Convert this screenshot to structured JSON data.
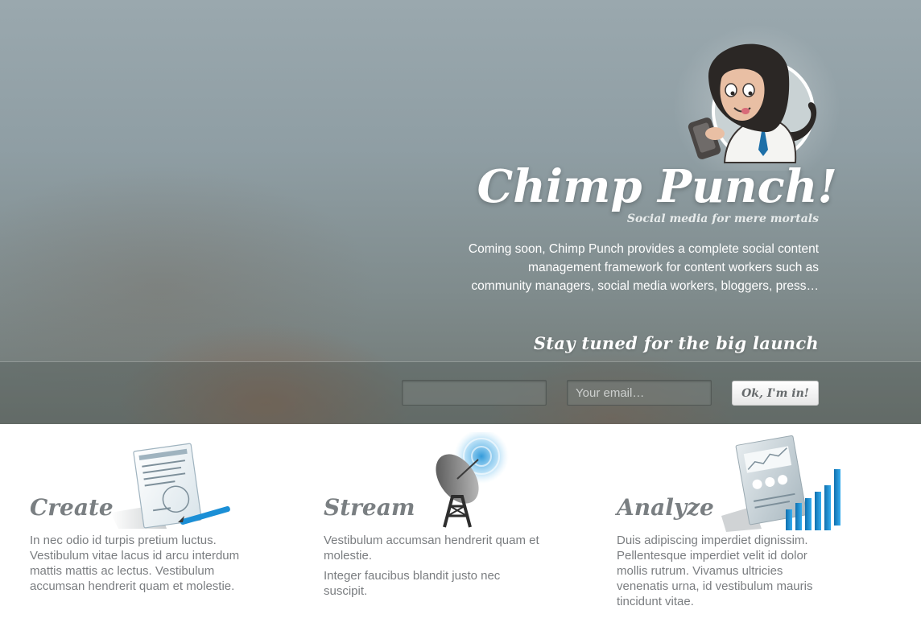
{
  "hero": {
    "title": "Chimp Punch!",
    "tagline": "Social media for mere mortals",
    "description": "Coming soon, Chimp Punch provides a complete social content management framework for content workers such as community managers, social media workers, bloggers, press…",
    "launch_heading": "Stay tuned for the big launch",
    "form": {
      "name_value": "",
      "name_placeholder": "",
      "email_value": "",
      "email_placeholder": "Your email…",
      "submit_label": "Ok, I'm in!"
    }
  },
  "features": [
    {
      "title": "Create",
      "icon": "document-pencil-icon",
      "paragraphs": [
        "In nec odio id turpis pretium luctus. Vestibulum vitae lacus id arcu interdum mattis mattis ac lectus. Vestibulum accumsan hendrerit quam et molestie."
      ]
    },
    {
      "title": "Stream",
      "icon": "satellite-dish-icon",
      "paragraphs": [
        "Vestibulum accumsan hendrerit quam et molestie.",
        "Integer faucibus blandit justo nec suscipit."
      ]
    },
    {
      "title": "Analyze",
      "icon": "report-bar-chart-icon",
      "paragraphs": [
        "Duis adipiscing imperdiet dignissim. Pellentesque imperdiet velit id dolor mollis rutrum. Vivamus ultricies venenatis urna, id vestibulum mauris tincidunt vitae."
      ]
    }
  ],
  "colors": {
    "hero_top": "#9aa8ae",
    "hero_bottom": "#6f7672",
    "feature_heading": "#7a7f82",
    "feature_text": "#7a7d80",
    "accent_blue": "#1b8fd6"
  }
}
